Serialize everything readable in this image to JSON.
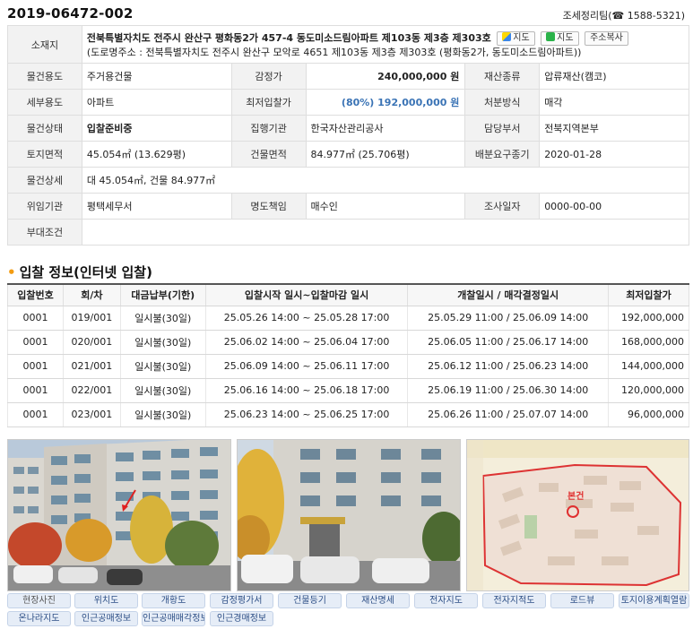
{
  "header": {
    "case_no": "2019-06472-002",
    "team": "조세정리팀(☎ 1588-5321)"
  },
  "info": {
    "address_label": "소재지",
    "address_main": "전북특별자치도 전주시 완산구 평화동2가 457-4 동도미소드림아파트 제103동 제3층 제303호",
    "address_road": "(도로명주소 : 전북특별자치도 전주시 완산구 모악로 4651 제103동 제3층 제303호 (평화동2가, 동도미소드림아파트))",
    "btn_kakao_map": "지도",
    "btn_naver_map": "지도",
    "btn_copy_address": "주소복사",
    "rows": [
      {
        "l1": "물건용도",
        "v1": "주거용건물",
        "l2": "감정가",
        "v2": "240,000,000 원",
        "l3": "재산종류",
        "v3": "압류재산(캠코)"
      },
      {
        "l1": "세부용도",
        "v1": "아파트",
        "l2": "최저입찰가",
        "v2": "(80%) 192,000,000 원",
        "l3": "처분방식",
        "v3": "매각"
      },
      {
        "l1": "물건상태",
        "v1": "입찰준비중",
        "l2": "집행기관",
        "v2": "한국자산관리공사",
        "l3": "담당부서",
        "v3": "전북지역본부"
      },
      {
        "l1": "토지면적",
        "v1": "45.054㎡ (13.629평)",
        "l2": "건물면적",
        "v2": "84.977㎡ (25.706평)",
        "l3": "배분요구종기",
        "v3": "2020-01-28"
      }
    ],
    "detail_label": "물건상세",
    "detail_value": "대 45.054㎡, 건물 84.977㎡",
    "delegate_label": "위임기관",
    "delegate_value": "평택세무서",
    "title_resp_label": "명도책임",
    "title_resp_value": "매수인",
    "survey_label": "조사일자",
    "survey_value": "0000-00-00",
    "condition_label": "부대조건",
    "condition_value": ""
  },
  "bid_section": {
    "title": "입찰 정보(인터넷 입찰)",
    "headers": [
      "입찰번호",
      "회/차",
      "대금납부(기한)",
      "입찰시작 일시~입찰마감 일시",
      "개찰일시 / 매각결정일시",
      "최저입찰가"
    ],
    "rows": [
      [
        "0001",
        "019/001",
        "일시불(30일)",
        "25.05.26 14:00 ~ 25.05.28 17:00",
        "25.05.29 11:00 / 25.06.09 14:00",
        "192,000,000"
      ],
      [
        "0001",
        "020/001",
        "일시불(30일)",
        "25.06.02 14:00 ~ 25.06.04 17:00",
        "25.06.05 11:00 / 25.06.17 14:00",
        "168,000,000"
      ],
      [
        "0001",
        "021/001",
        "일시불(30일)",
        "25.06.09 14:00 ~ 25.06.11 17:00",
        "25.06.12 11:00 / 25.06.23 14:00",
        "144,000,000"
      ],
      [
        "0001",
        "022/001",
        "일시불(30일)",
        "25.06.16 14:00 ~ 25.06.18 17:00",
        "25.06.19 11:00 / 25.06.30 14:00",
        "120,000,000"
      ],
      [
        "0001",
        "023/001",
        "일시불(30일)",
        "25.06.23 14:00 ~ 25.06.25 17:00",
        "25.06.26 11:00 / 25.07.07 14:00",
        "96,000,000"
      ]
    ]
  },
  "map_label": "본건",
  "tabs": [
    "현장사진",
    "위치도",
    "개황도",
    "감정평가서",
    "건물등기",
    "재산명세",
    "전자지도",
    "전자지적도",
    "로드뷰",
    "토지이용계획열람",
    "온나라지도",
    "인근공매정보",
    "인근공매매각정보",
    "인근경매정보"
  ],
  "colors": {
    "accent_blue": "#3a73b5",
    "section_dot": "#f39c12",
    "tab_bg": "#e6edf7",
    "tab_text": "#2d4f86"
  }
}
